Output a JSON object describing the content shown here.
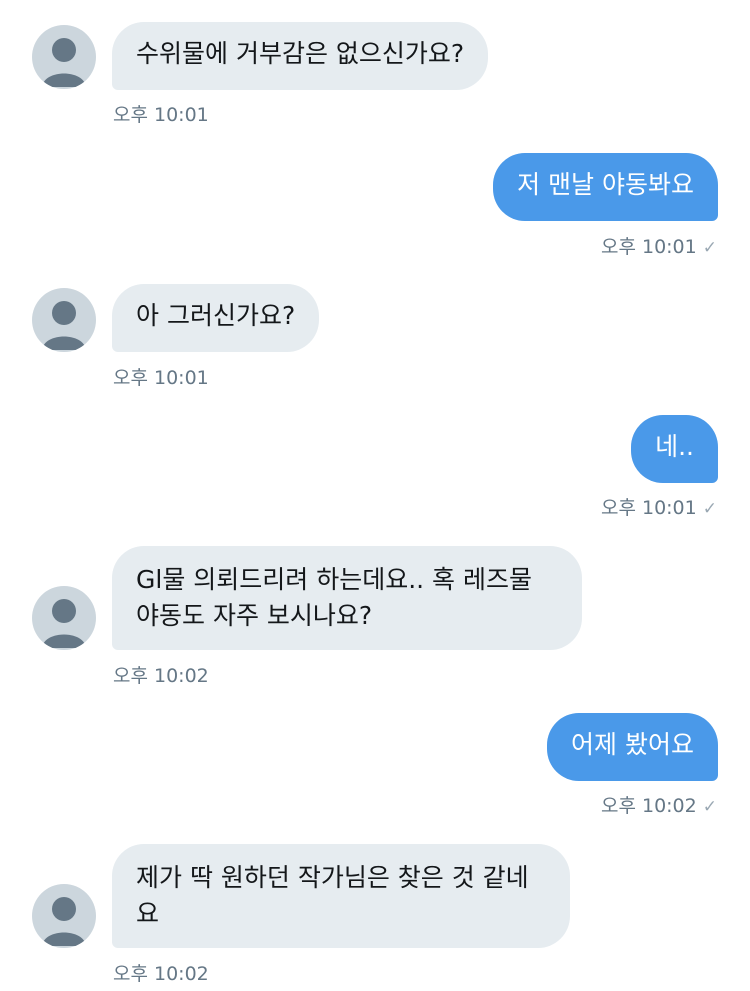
{
  "messages": [
    {
      "side": "in",
      "text": "수위물에 거부감은 없으신가요?",
      "time": "오후 10:01"
    },
    {
      "side": "out",
      "text": "저 맨날 야동봐요",
      "time": "오후 10:01"
    },
    {
      "side": "in",
      "text": "아 그러신가요?",
      "time": "오후 10:01"
    },
    {
      "side": "out",
      "text": "네..",
      "time": "오후 10:01"
    },
    {
      "side": "in",
      "lines": [
        "Gl물 의뢰드리려 하는데요.. 혹 레즈물",
        "야동도 자주 보시나요?"
      ],
      "time": "오후 10:02"
    },
    {
      "side": "out",
      "text": "어제 봤어요",
      "time": "오후 10:02"
    },
    {
      "side": "in",
      "lines": [
        "제가 딱 원하던 작가님은 찾은 것 같네",
        "요"
      ],
      "time": "오후 10:02"
    }
  ],
  "icons": {
    "avatar": "default-profile-avatar-icon",
    "read_receipt": "checkmark-icon"
  },
  "colors": {
    "incoming_bubble": "#e6ecf0",
    "outgoing_bubble": "#4a99e9",
    "timestamp": "#657786",
    "avatar_bg": "#ccd6dd",
    "avatar_fg": "#657786"
  },
  "read_mark": "✓"
}
